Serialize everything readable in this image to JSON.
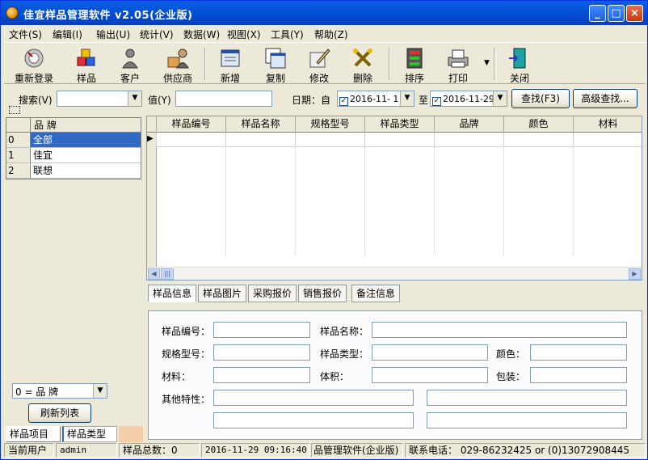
{
  "window": {
    "title": "佳宜样品管理软件  v2.05(企业版)"
  },
  "menu": [
    "文件(S)",
    "编辑(I)",
    "输出(U)",
    "统计(V)",
    "数据(W)",
    "视图(X)",
    "工具(Y)",
    "帮助(Z)"
  ],
  "toolbar": [
    {
      "label": "重新登录",
      "icon": "relogin-icon"
    },
    {
      "label": "样品",
      "icon": "sample-icon"
    },
    {
      "label": "客户",
      "icon": "customer-icon"
    },
    {
      "label": "供应商",
      "icon": "supplier-icon"
    },
    {
      "label": "新增",
      "icon": "new-icon"
    },
    {
      "label": "复制",
      "icon": "copy-icon"
    },
    {
      "label": "修改",
      "icon": "edit-icon"
    },
    {
      "label": "删除",
      "icon": "delete-icon"
    },
    {
      "label": "排序",
      "icon": "sort-icon"
    },
    {
      "label": "打印",
      "icon": "print-icon"
    },
    {
      "label": "关闭",
      "icon": "close-door-icon"
    }
  ],
  "search": {
    "search_label": "搜索(V)",
    "value_label": "值(Y)",
    "date_label": "日期：自",
    "date_from": "2016-11- 1",
    "to_label": "至",
    "date_to": "2016-11-29",
    "find_button": "查找(F3)",
    "advanced_button": "高级查找..."
  },
  "brands": {
    "header": "品    牌",
    "rows": [
      {
        "idx": "0",
        "name": "全部"
      },
      {
        "idx": "1",
        "name": "佳宜"
      },
      {
        "idx": "2",
        "name": "联想"
      }
    ],
    "selected_index": 0
  },
  "left_footer": {
    "combo_value": "0 = 品    牌",
    "refresh_button": "刷新列表",
    "tabs": [
      "样品项目",
      "样品类型"
    ]
  },
  "grid": {
    "columns": [
      "样品编号",
      "样品名称",
      "规格型号",
      "样品类型",
      "品牌",
      "颜色",
      "材料"
    ]
  },
  "detail_tabs": [
    "样品信息",
    "样品图片",
    "采购报价",
    "销售报价",
    "备注信息"
  ],
  "detail_fields": {
    "code": "样品编号：",
    "name": "样品名称：",
    "spec": "规格型号：",
    "type": "样品类型：",
    "color": "颜色：",
    "material": "材料：",
    "volume": "体积：",
    "package": "包装：",
    "other": "其他特性："
  },
  "status": {
    "user_label": "当前用户",
    "user": "admin",
    "total": "样品总数：0",
    "datetime": "2016-11-29 09:16:40",
    "product": "品管理软件(企业版)",
    "contact": "联系电话：   029-86232425 or (0)13072908445"
  },
  "colors": {
    "title_bar": "#0a5fe6",
    "selection": "#316ac5",
    "face": "#ece9d8"
  }
}
